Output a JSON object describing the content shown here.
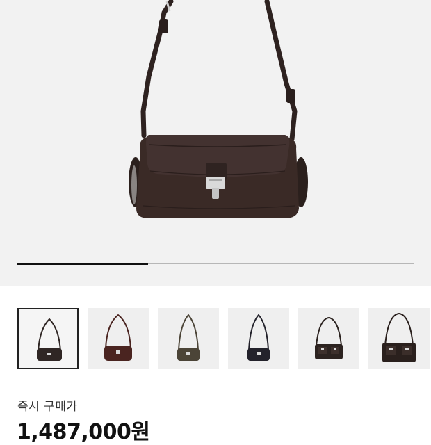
{
  "product": {
    "image_alt": "leather shoulder bag",
    "colors": {
      "hero_background": "#f2f2f2",
      "bag_leather": "#3a2a26",
      "strap": "#2e2220",
      "clasp": "#d9d9d9"
    }
  },
  "gallery": {
    "progress_fraction": 0.33,
    "thumbnails": [
      {
        "name": "bag-espresso",
        "color": "#2f2624",
        "selected": true
      },
      {
        "name": "bag-burgundy",
        "color": "#4a2420",
        "selected": false
      },
      {
        "name": "bag-olive",
        "color": "#4b4437",
        "selected": false
      },
      {
        "name": "bag-navy",
        "color": "#23222b",
        "selected": false
      },
      {
        "name": "bag-two-pocket-dark",
        "color": "#2c2320",
        "selected": false
      },
      {
        "name": "bag-two-pocket-large",
        "color": "#2a201d",
        "selected": false
      }
    ]
  },
  "pricing": {
    "label": "즉시 구매가",
    "value": "1,487,000원"
  }
}
